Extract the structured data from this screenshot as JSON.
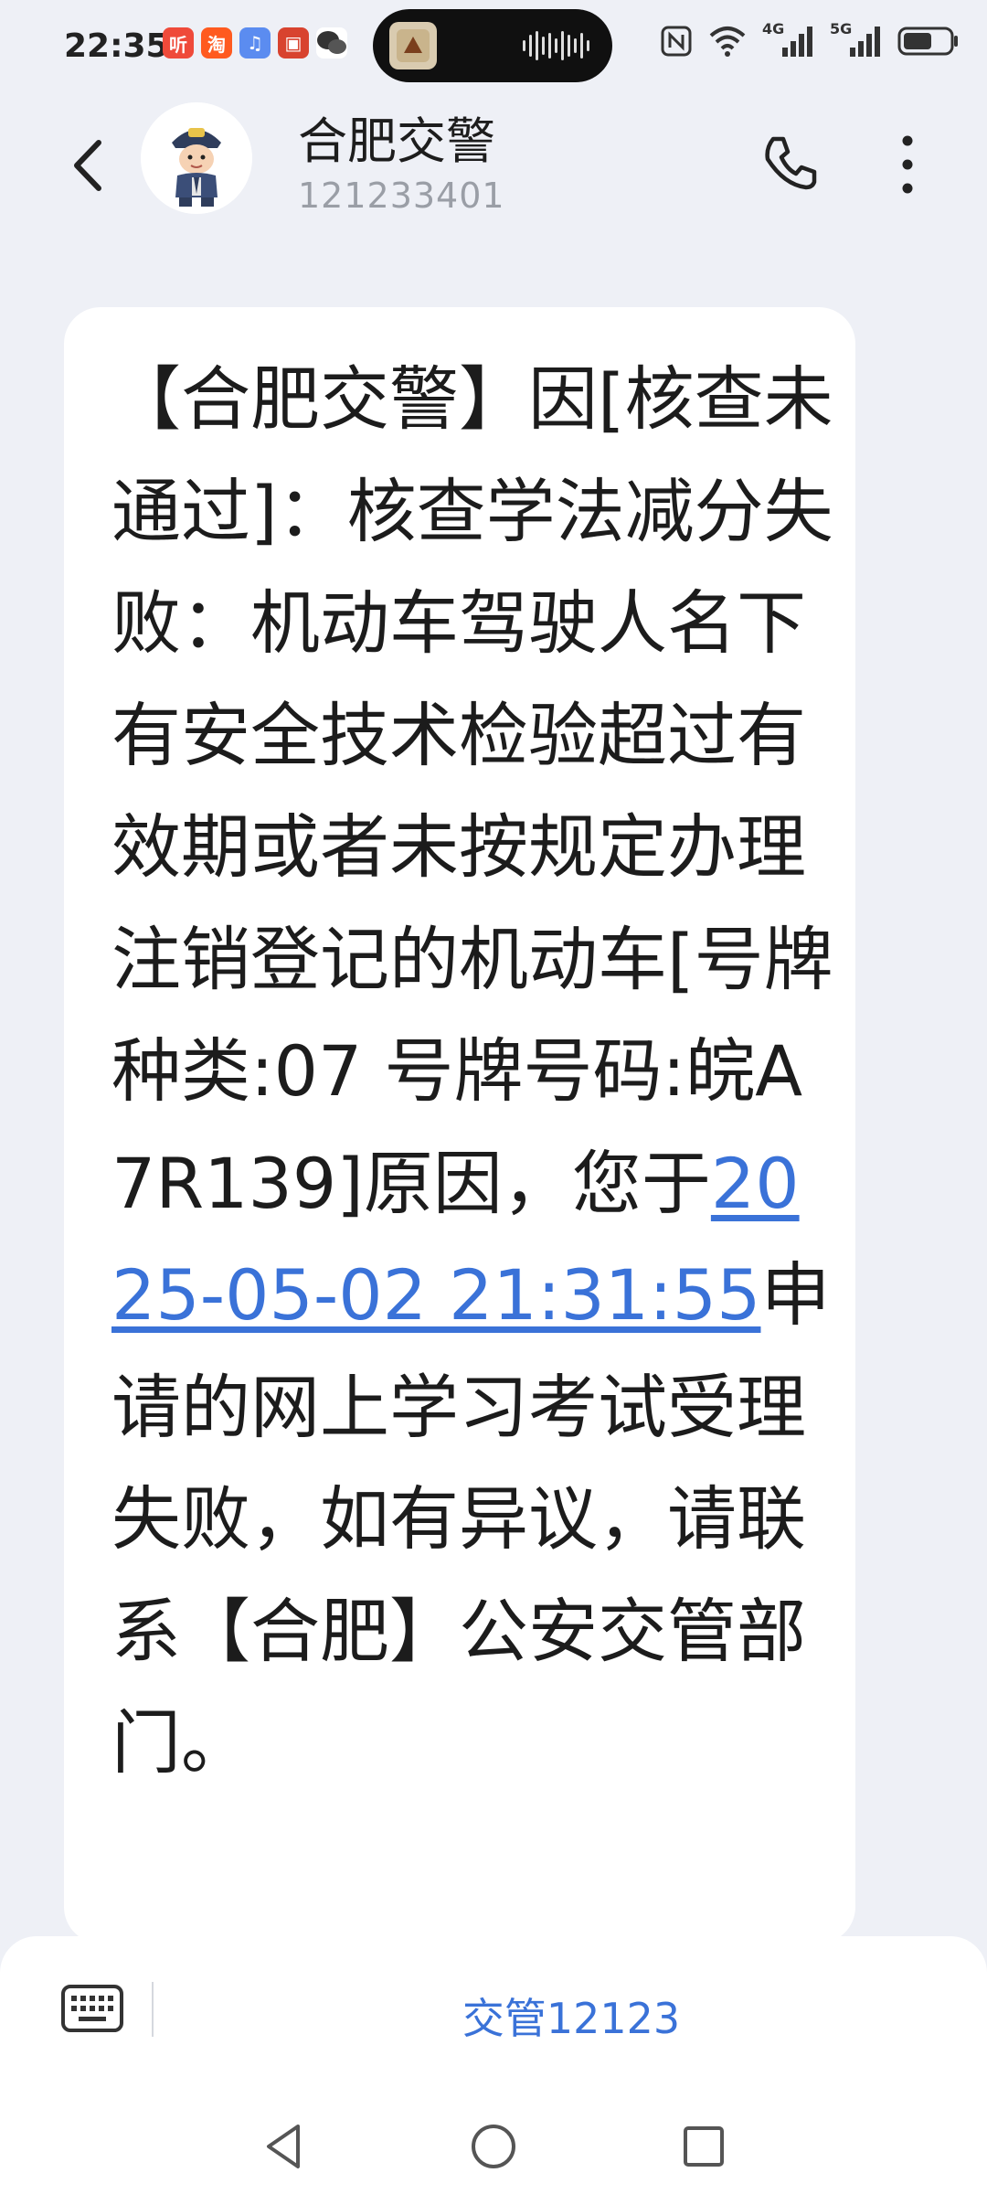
{
  "status_bar": {
    "time": "22:35",
    "app_icons": [
      {
        "name": "ting-app-icon",
        "label": "听",
        "color": "#ef4a3a"
      },
      {
        "name": "taobao-app-icon",
        "label": "淘",
        "color": "#ff5a1f"
      },
      {
        "name": "music-app-icon",
        "label": "♫",
        "color": "#5b8cf0"
      },
      {
        "name": "game-app-icon",
        "label": "▣",
        "color": "#d8432f"
      },
      {
        "name": "wechat-app-icon",
        "label": "●",
        "color": "#2a2a2a"
      }
    ],
    "network_label": "4G",
    "network_label_2": "5G"
  },
  "header": {
    "title": "合肥交警",
    "number": "121233401"
  },
  "message": {
    "text_before": "【合肥交警】因[核查未通过]：核查学法减分失败：机动车驾驶人名下有安全技术检验超过有效期或者未按规定办理注销登记的机动车[号牌种类:07 号牌号码:皖A7R139]原因，您于",
    "link_text": "2025-05-02 21:31:55",
    "text_after": "申请的网上学习考试受理失败，如有异议，请联系【合肥】公安交管部门。"
  },
  "bottom_bar": {
    "quick_reply": "交管12123"
  },
  "colors": {
    "accent": "#3a72d8",
    "background": "#eef0f6"
  }
}
